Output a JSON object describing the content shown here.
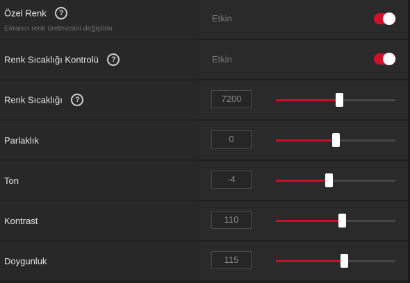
{
  "settings": [
    {
      "key": "ozel-renk",
      "kind": "toggle",
      "label": "Özel Renk",
      "sublabel": "Ekranın renk üretmesini değiştirin",
      "status": "Etkin",
      "enabled": true,
      "icon": "help-circle-icon"
    },
    {
      "key": "renk-sicakligi-kontrolu",
      "kind": "toggle",
      "label": "Renk Sıcaklığı Kontrolü",
      "status": "Etkin",
      "enabled": true,
      "icon": "help-circle-icon"
    },
    {
      "key": "renk-sicakligi",
      "kind": "slider",
      "label": "Renk Sıcaklığı",
      "value": "7200",
      "level": 0.53,
      "icon": "help-circle-icon"
    },
    {
      "key": "parlaklik",
      "kind": "slider",
      "label": "Parlaklık",
      "value": "0",
      "level": 0.5
    },
    {
      "key": "ton",
      "kind": "slider",
      "label": "Ton",
      "value": "-4",
      "level": 0.44
    },
    {
      "key": "kontrast",
      "kind": "slider",
      "label": "Kontrast",
      "value": "110",
      "level": 0.55
    },
    {
      "key": "doygunluk",
      "kind": "slider",
      "label": "Doygunluk",
      "value": "115",
      "level": 0.57
    }
  ],
  "colors": {
    "accent": "#d3102c",
    "panel": "#282828",
    "text": "#e6e6e6",
    "muted": "#7a7a7a"
  }
}
